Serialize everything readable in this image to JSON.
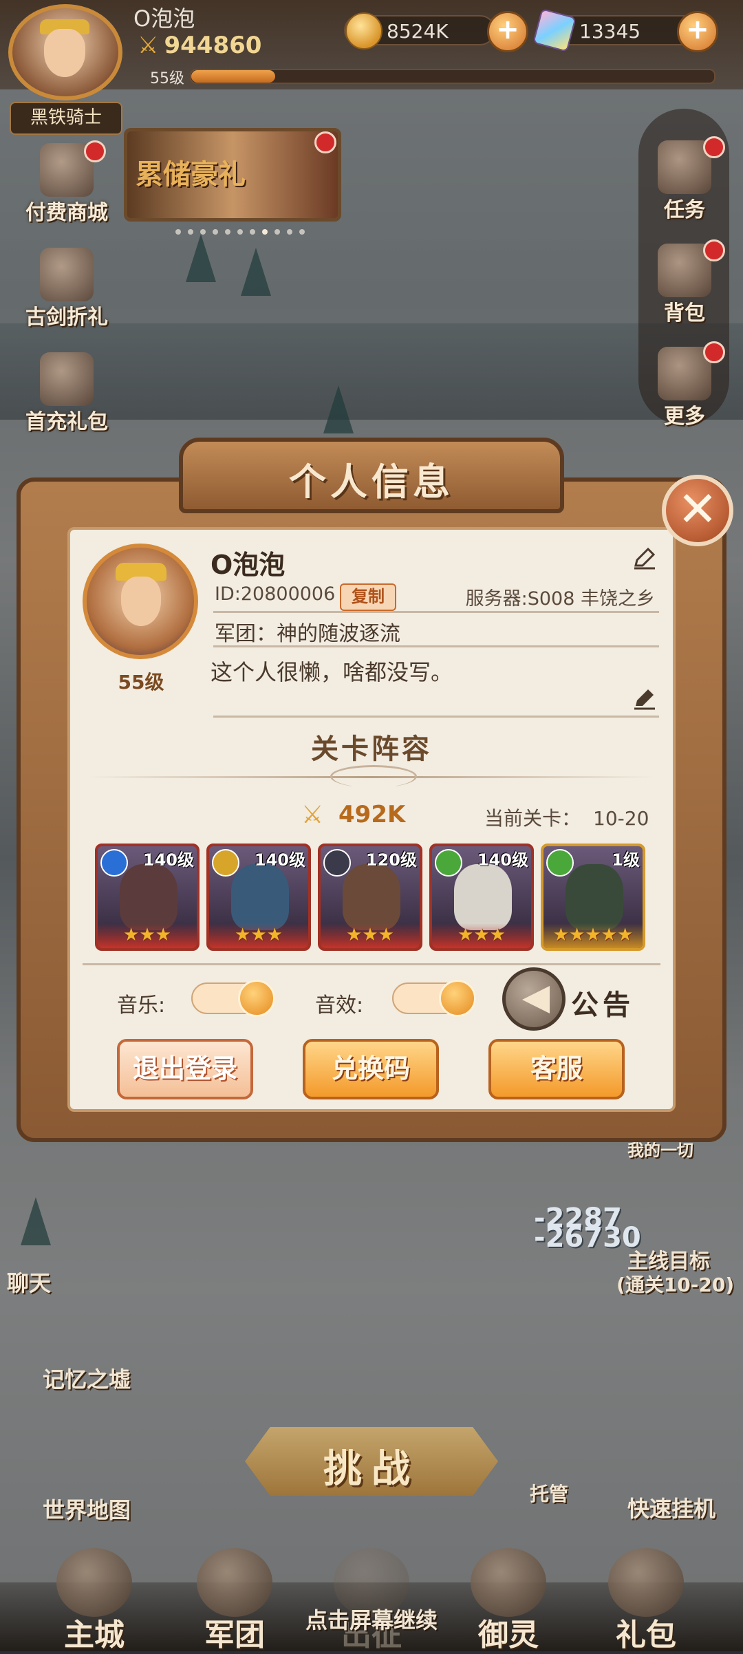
{
  "player": {
    "name": "O泡泡",
    "power": "944860",
    "level": "55级",
    "title": "黑铁骑士",
    "exp_fraction": 0.16
  },
  "resources": {
    "gold": "8524K",
    "gems": "13345",
    "plus_symbol": "+"
  },
  "left_menu": [
    {
      "label": "付费商城"
    },
    {
      "label": "古剑折礼"
    },
    {
      "label": "首充礼包"
    }
  ],
  "event_banner": {
    "label": "累储豪礼",
    "pages": 11,
    "active_page": 7
  },
  "right_menu": [
    {
      "label": "任务"
    },
    {
      "label": "背包"
    },
    {
      "label": "更多"
    }
  ],
  "modal": {
    "title": "个人信息",
    "close_symbol": "✕",
    "name": "O泡泡",
    "id_text": "ID:20800006",
    "copy_label": "复制",
    "server_text": "服务器:S008 丰饶之乡",
    "guild_text": "军团：神的随波逐流",
    "signature": "这个人很懒，啥都没写。",
    "level": "55级",
    "lineup_title": "关卡阵容",
    "team_power": "492K",
    "current_stage_label": "当前关卡：",
    "current_stage_value": "10-20",
    "heroes": [
      {
        "level": "140级",
        "stars": "★★★",
        "element_color": "#2a6fd6",
        "portrait_color": "#5b3b3b"
      },
      {
        "level": "140级",
        "stars": "★★★",
        "element_color": "#d6a52a",
        "portrait_color": "#3a5a7a"
      },
      {
        "level": "120级",
        "stars": "★★★",
        "element_color": "#3a3a4a",
        "portrait_color": "#6b4a3a"
      },
      {
        "level": "140级",
        "stars": "★★★",
        "element_color": "#4aa83a",
        "portrait_color": "#d8d4cc"
      },
      {
        "level": "1级",
        "stars": "★★★★★",
        "element_color": "#4aa83a",
        "portrait_color": "#3a4a3a"
      }
    ],
    "music_label": "音乐:",
    "sfx_label": "音效:",
    "notice_label": "公告",
    "logout_label": "退出登录",
    "redeem_label": "兑换码",
    "support_label": "客服"
  },
  "hud": {
    "chat_label": "聊天",
    "memory_label": "记忆之墟",
    "world_map_label": "世界地图",
    "challenge_label": "挑战",
    "auto_label": "托管",
    "quick_idle_label": "快速挂机",
    "main_quest_label": "主线目标",
    "main_quest_sub": "(通关10-20)",
    "top_scroll_text": "我的一切",
    "damage_1": "-2287",
    "damage_2": "-26730",
    "continue_text": "点击屏幕继续"
  },
  "bottom_tabs": [
    {
      "label": "主城"
    },
    {
      "label": "军团"
    },
    {
      "label": "出征"
    },
    {
      "label": "御灵"
    },
    {
      "label": "礼包"
    }
  ],
  "colors": {
    "frame": "#8a5a34",
    "panel": "#f2ece1",
    "accent_orange": "#f39a2a",
    "badge_red": "#d22a2a"
  }
}
